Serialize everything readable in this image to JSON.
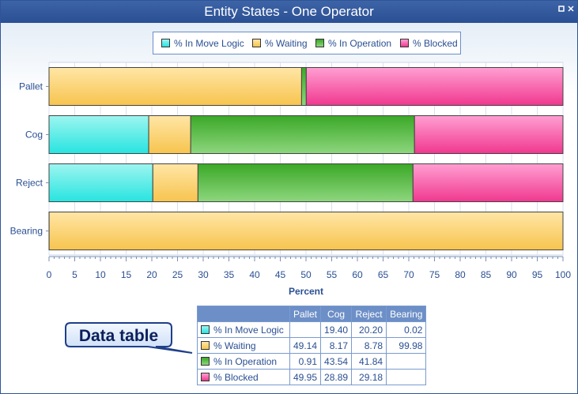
{
  "window": {
    "title": "Entity States - One Operator",
    "icons": [
      "restore-icon",
      "close-icon"
    ]
  },
  "callout": {
    "label": "Data table"
  },
  "colors": {
    "% In Move Logic": [
      "#9ef5f0",
      "#27e4e0"
    ],
    "% Waiting": [
      "#ffe6a6",
      "#f7c44e"
    ],
    "% In Operation": [
      "#3aa827",
      "#8ed67e"
    ],
    "% Blocked": [
      "#ff9fd2",
      "#f0388f"
    ]
  },
  "chart_data": {
    "type": "bar",
    "orientation": "horizontal",
    "stacked": true,
    "categories": [
      "Pallet",
      "Cog",
      "Reject",
      "Bearing"
    ],
    "series": [
      {
        "name": "% In Move Logic",
        "values": [
          0,
          19.4,
          20.2,
          0.02
        ],
        "display": [
          "",
          "19.40",
          "20.20",
          "0.02"
        ]
      },
      {
        "name": "% Waiting",
        "values": [
          49.14,
          8.17,
          8.78,
          99.98
        ],
        "display": [
          "49.14",
          "8.17",
          "8.78",
          "99.98"
        ]
      },
      {
        "name": "% In Operation",
        "values": [
          0.91,
          43.54,
          41.84,
          0
        ],
        "display": [
          "0.91",
          "43.54",
          "41.84",
          ""
        ]
      },
      {
        "name": "% Blocked",
        "values": [
          49.95,
          28.89,
          29.18,
          0
        ],
        "display": [
          "49.95",
          "28.89",
          "29.18",
          ""
        ]
      }
    ],
    "xlabel": "Percent",
    "xlim": [
      0,
      100
    ],
    "xticks": [
      0,
      5,
      10,
      15,
      20,
      25,
      30,
      35,
      40,
      45,
      50,
      55,
      60,
      65,
      70,
      75,
      80,
      85,
      90,
      95,
      100
    ],
    "grid": true,
    "legend": "top-center",
    "data_table": true
  }
}
